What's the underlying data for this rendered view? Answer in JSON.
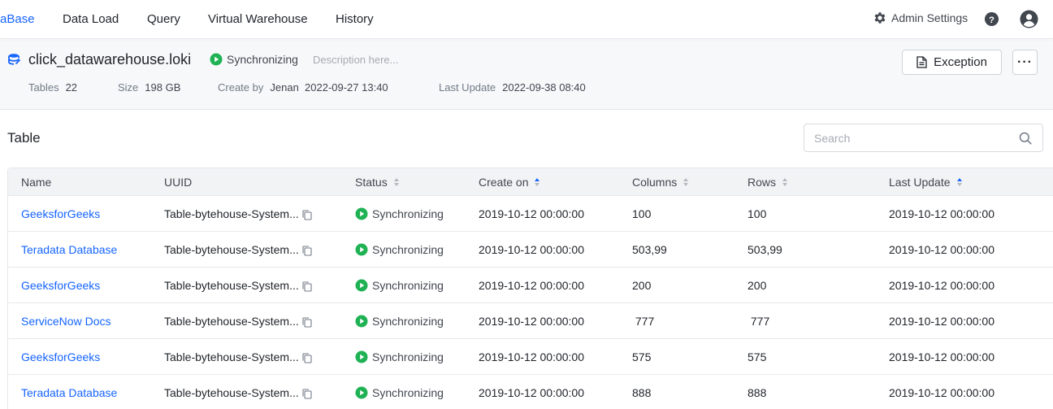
{
  "nav": {
    "brand": "aBase",
    "items": [
      "Data Load",
      "Query",
      "Virtual Warehouse",
      "History"
    ],
    "admin_label": "Admin Settings",
    "icons": {
      "admin": "gear-icon",
      "help": "help-icon",
      "user": "user-avatar-icon"
    }
  },
  "database": {
    "name": "click_datawarehouse.loki",
    "status": "Synchronizing",
    "description_placeholder": "Description here...",
    "meta": {
      "tables_label": "Tables",
      "tables_value": "22",
      "size_label": "Size",
      "size_value": "198 GB",
      "create_by_label": "Create by",
      "create_by_value": "Jenan  2022-09-27 13:40",
      "last_update_label": "Last Update",
      "last_update_value": "2022-09-38 08:40"
    },
    "exception_label": "Exception",
    "more_label": "···"
  },
  "table_section": {
    "title": "Table",
    "search_placeholder": "Search",
    "columns": [
      "Name",
      "UUID",
      "Status",
      "Create on",
      "Columns",
      "Rows",
      "Last Update"
    ],
    "rows": [
      {
        "name": "GeeksforGeeks",
        "uuid": "Table-bytehouse-System...",
        "status": "Synchronizing",
        "create_on": "2019-10-12 00:00:00",
        "columns": "100",
        "rows": "100",
        "last_update": "2019-10-12 00:00:00"
      },
      {
        "name": "Teradata Database",
        "uuid": "Table-bytehouse-System...",
        "status": "Synchronizing",
        "create_on": "2019-10-12 00:00:00",
        "columns": "503,99",
        "rows": "503,99",
        "last_update": "2019-10-12 00:00:00"
      },
      {
        "name": "GeeksforGeeks",
        "uuid": "Table-bytehouse-System...",
        "status": "Synchronizing",
        "create_on": "2019-10-12 00:00:00",
        "columns": "200",
        "rows": "200",
        "last_update": "2019-10-12 00:00:00"
      },
      {
        "name": "ServiceNow Docs",
        "uuid": "Table-bytehouse-System...",
        "status": "Synchronizing",
        "create_on": "2019-10-12 00:00:00",
        "columns": " 777",
        "rows": " 777",
        "last_update": "2019-10-12 00:00:00"
      },
      {
        "name": "GeeksforGeeks",
        "uuid": "Table-bytehouse-System...",
        "status": "Synchronizing",
        "create_on": "2019-10-12 00:00:00",
        "columns": "575",
        "rows": "575",
        "last_update": "2019-10-12 00:00:00"
      },
      {
        "name": "Teradata Database",
        "uuid": "Table-bytehouse-System...",
        "status": "Synchronizing",
        "create_on": "2019-10-12 00:00:00",
        "columns": "888",
        "rows": "888",
        "last_update": "2019-10-12 00:00:00"
      }
    ]
  },
  "colors": {
    "accent": "#1664ff",
    "status_green": "#1fb254"
  }
}
